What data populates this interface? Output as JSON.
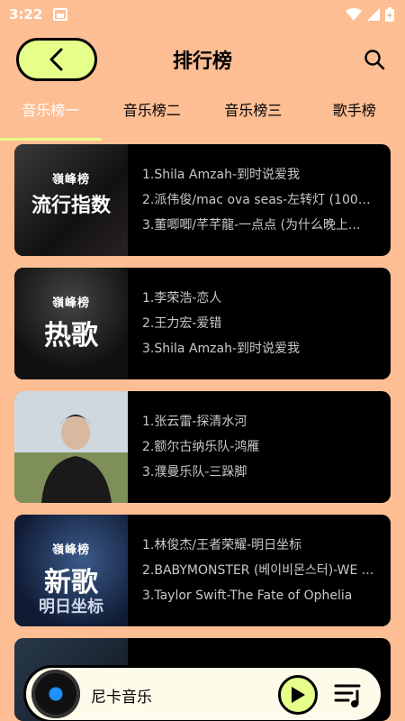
{
  "status": {
    "time": "3:22"
  },
  "header": {
    "title": "排行榜"
  },
  "tabs": [
    {
      "label": "音乐榜一"
    },
    {
      "label": "音乐榜二"
    },
    {
      "label": "音乐榜三"
    },
    {
      "label": "歌手榜"
    }
  ],
  "charts": [
    {
      "cover_logo": "嶺峰榜",
      "cover_title": "流行指数",
      "songs": [
        "1.Shila Amzah-到时说爱我",
        "2.派伟俊/mac ova seas-左转灯 (1000...",
        "3.董唧唧/芊芊龍-一点点 (为什么晚上..."
      ]
    },
    {
      "cover_logo": "嶺峰榜",
      "cover_title": "热歌",
      "songs": [
        "1.李荣浩-恋人",
        "2.王力宏-爱错",
        "3.Shila Amzah-到时说爱我"
      ]
    },
    {
      "cover_logo": "",
      "cover_title": "",
      "songs": [
        "1.张云雷-探清水河",
        "2.额尔古纳乐队-鸿雁",
        "3.濮曼乐队-三跺脚"
      ]
    },
    {
      "cover_logo": "嶺峰榜",
      "cover_title": "新歌",
      "cover_sub": "明日坐标",
      "songs": [
        "1.林俊杰/王者荣耀-明日坐标",
        "2.BABYMONSTER (베이비몬스터)-WE ...",
        "3.Taylor Swift-The Fate of Ophelia"
      ]
    }
  ],
  "player": {
    "name": "尼卡音乐"
  },
  "colors": {
    "background": "#FDBE94",
    "accent": "#E5FF8A",
    "card": "#000000"
  }
}
